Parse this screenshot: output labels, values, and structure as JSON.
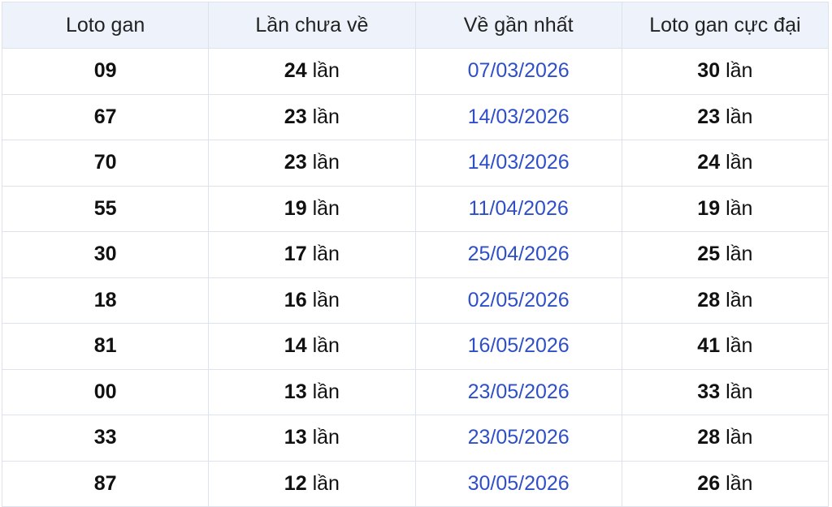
{
  "columns": [
    "Loto gan",
    "Lần chưa về",
    "Về gần nhất",
    "Loto gan cực đại"
  ],
  "unit": "lần",
  "colors": {
    "header_bg": "#eef3fb",
    "border": "#dde3ec",
    "date_text": "#2f4fc9"
  },
  "rows": [
    {
      "loto": "09",
      "missed": "24",
      "last_seen": "07/03/2026",
      "max_gan": "30"
    },
    {
      "loto": "67",
      "missed": "23",
      "last_seen": "14/03/2026",
      "max_gan": "23"
    },
    {
      "loto": "70",
      "missed": "23",
      "last_seen": "14/03/2026",
      "max_gan": "24"
    },
    {
      "loto": "55",
      "missed": "19",
      "last_seen": "11/04/2026",
      "max_gan": "19"
    },
    {
      "loto": "30",
      "missed": "17",
      "last_seen": "25/04/2026",
      "max_gan": "25"
    },
    {
      "loto": "18",
      "missed": "16",
      "last_seen": "02/05/2026",
      "max_gan": "28"
    },
    {
      "loto": "81",
      "missed": "14",
      "last_seen": "16/05/2026",
      "max_gan": "41"
    },
    {
      "loto": "00",
      "missed": "13",
      "last_seen": "23/05/2026",
      "max_gan": "33"
    },
    {
      "loto": "33",
      "missed": "13",
      "last_seen": "23/05/2026",
      "max_gan": "28"
    },
    {
      "loto": "87",
      "missed": "12",
      "last_seen": "30/05/2026",
      "max_gan": "26"
    }
  ]
}
